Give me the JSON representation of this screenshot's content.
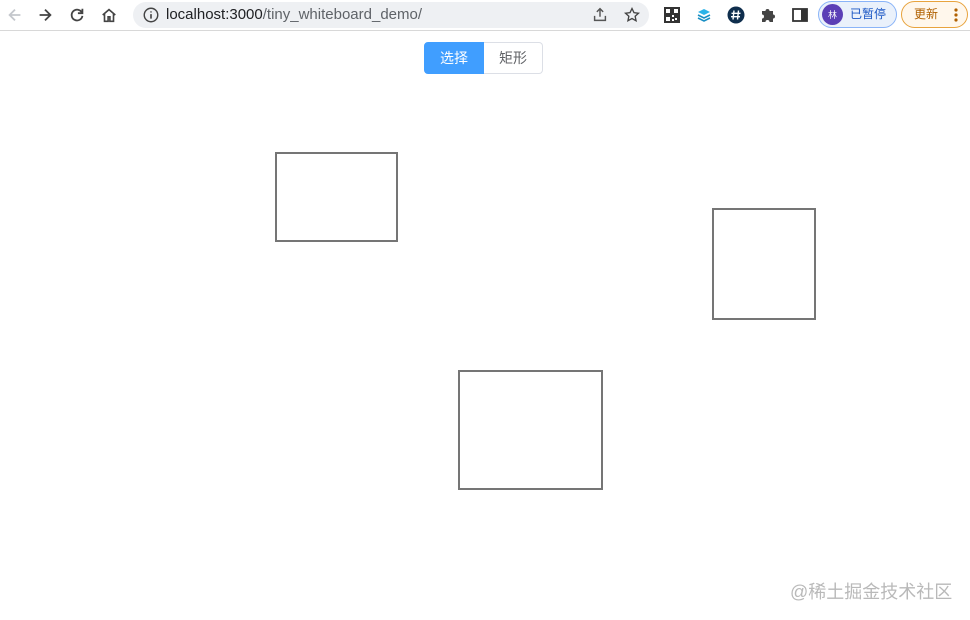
{
  "browser": {
    "url_host": "localhost:3000",
    "url_path": "/tiny_whiteboard_demo/",
    "profile_initials": "林",
    "profile_status": "已暂停",
    "update_label": "更新"
  },
  "toolbar": {
    "select_label": "选择",
    "rect_label": "矩形"
  },
  "canvas": {
    "shapes": [
      {
        "type": "rectangle",
        "stroke": "#757575"
      },
      {
        "type": "rectangle",
        "stroke": "#757575"
      },
      {
        "type": "rectangle",
        "stroke": "#757575"
      }
    ]
  },
  "watermark": "@稀土掘金技术社区",
  "colors": {
    "accent": "#409eff",
    "shape_stroke": "#757575"
  }
}
